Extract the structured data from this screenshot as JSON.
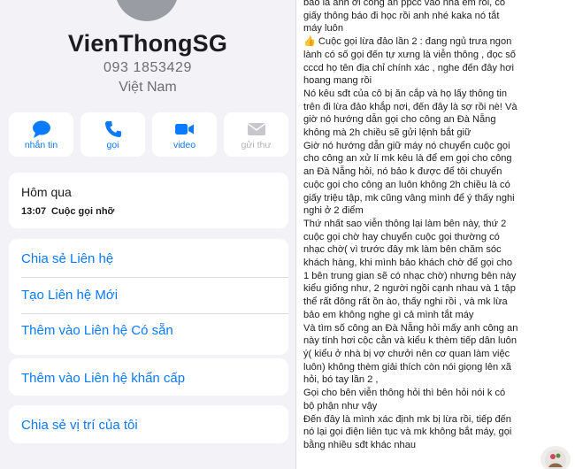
{
  "contact": {
    "name": "VienThongSG",
    "phone": "093 1853429",
    "country": "Việt Nam"
  },
  "actions": [
    {
      "label": "nhắn tin",
      "icon": "message-icon",
      "enabled": true
    },
    {
      "label": "gọi",
      "icon": "phone-icon",
      "enabled": true
    },
    {
      "label": "video",
      "icon": "video-icon",
      "enabled": true
    },
    {
      "label": "gửi thư",
      "icon": "mail-icon",
      "enabled": false
    }
  ],
  "recent": {
    "heading": "Hôm qua",
    "time": "13:07",
    "description": "Cuộc gọi nhỡ"
  },
  "menu": {
    "share_contact": "Chia sẻ Liên hệ",
    "new_contact": "Tạo Liên hệ Mới",
    "add_existing": "Thêm vào Liên hệ Có sẵn",
    "add_emergency": "Thêm vào Liên hệ khẩn cấp",
    "share_location": "Chia sẻ vị trí của tôi"
  },
  "message_lines": [
    "bảo là anh ơi công an ppcc vào nhà em rồi, có",
    "giấy thông báo đi học rồi anh nhé kaka nó tắt",
    "máy luôn",
    "👍 Cuộc gọi lừa đảo lần 2 : đang ngủ trưa ngon",
    "lành có số gọi đến tự xưng là viễn thông , đọc số",
    "cccd họ tên địa chỉ chính xác , nghe đến đây hơi",
    "hoang mang rồi",
    "Nó kêu sđt của cô bị ăn cắp và họ lấy thông tin",
    "trên đi lừa đảo khắp nơi, đến đây là sợ rồi nè! Và",
    "giờ nó hướng dẫn gọi cho công an Đà Nẵng",
    "không mà 2h chiều sẽ gửi lệnh bắt giữ",
    "Giờ nó hướng dẫn giữ máy nó chuyển cuộc gọi",
    "cho công an xử lí mk kêu là để em gọi cho công",
    "an Đà Nẵng hỏi, nó bảo k được để tôi chuyển",
    "cuộc gọi cho công an luôn không 2h chiều là có",
    "giấy triệu tập, mk cũng vâng mình để ý thấy nghi",
    "nghi ở 2 điểm",
    "Thứ nhất sao viễn thông lại làm bên này, thứ 2",
    "cuộc gọi chờ hay chuyển cuộc gọi thường có",
    "nhạc chờ( vì trước đây mk làm bên chăm sóc",
    "khách hàng, khi mình bảo khách chờ để gọi cho",
    "1 bên trung gian sẽ có nhạc chờ) nhưng bên này",
    "kiểu giống như, 2 người ngồi cạnh nhau và 1 tập",
    "thể rất đông rất ồn ào, thấy nghi rồi , và mk lừa",
    "bảo em không nghe gì cả mình tắt máy",
    "Và tìm số công an Đà Nẵng hỏi mấy anh công an",
    "này tính hơi cộc cằn và kiểu k thèm tiếp dân luôn",
    "ý( kiểu ở nhà bị vợ chưởi nên cơ quan làm việc",
    "luôn) không thèm giải thích còn nói giọng lên xã",
    "hỏi, bó tay lần 2 ,",
    "Gọi cho bên viễn thông hỏi thì bên hỏi nói k có",
    "bộ phận như vậy",
    "Đến đây là mình xác định mk bị lừa rồi, tiếp đến",
    "nó lại gọi điện liên tục và mk không bắt máy, gọi",
    "bằng nhiều sđt khác nhau"
  ],
  "colors": {
    "accent": "#0a7aff",
    "background": "#f2f2f7",
    "card": "#ffffff",
    "disabled": "#b5b5ba"
  }
}
